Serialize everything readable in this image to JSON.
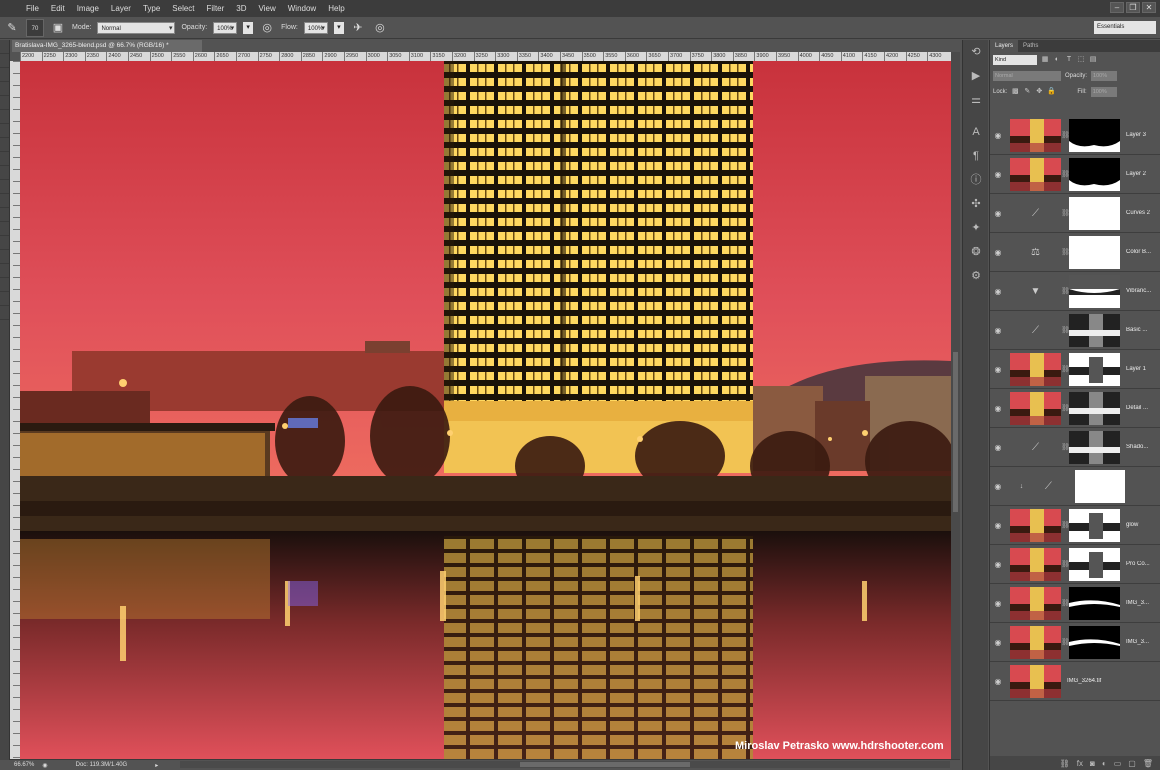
{
  "menubar": {
    "items": [
      "File",
      "Edit",
      "Image",
      "Layer",
      "Type",
      "Select",
      "Filter",
      "3D",
      "View",
      "Window",
      "Help"
    ]
  },
  "options": {
    "brush_size": "70",
    "mode_label": "Mode:",
    "mode_value": "Normal",
    "opacity_label": "Opacity:",
    "opacity_value": "100%",
    "flow_label": "Flow:",
    "flow_value": "100%",
    "workspace": "Essentials"
  },
  "document": {
    "tab_title": "Bratislava-IMG_3265-blend.psd @ 66.7% (RGB/16) *",
    "zoom": "66.67%",
    "doc_size": "Doc: 119.3M/1.40G",
    "watermark": "Miroslav Petrasko www.hdrshooter.com"
  },
  "ruler_ticks": [
    "2200",
    "2250",
    "2300",
    "2350",
    "2400",
    "2450",
    "2500",
    "2550",
    "2600",
    "2650",
    "2700",
    "2750",
    "2800",
    "2850",
    "2900",
    "2950",
    "3000",
    "3050",
    "3100",
    "3150",
    "3200",
    "3250",
    "3300",
    "3350",
    "3400",
    "3450",
    "3500",
    "3550",
    "3600",
    "3650",
    "3700",
    "3750",
    "3800",
    "3850",
    "3900",
    "3950",
    "4000",
    "4050",
    "4100",
    "4150",
    "4200",
    "4250",
    "4300"
  ],
  "layers_panel": {
    "tabs": [
      "Layers",
      "Paths"
    ],
    "filter_kind": "Kind",
    "blend_mode": "Normal",
    "opacity_label": "Opacity:",
    "opacity_value": "100%",
    "lock_label": "Lock:",
    "fill_label": "Fill:",
    "fill_value": "100%",
    "layers": [
      {
        "name": "Layer 3",
        "type": "image",
        "mask": "dark-bottom"
      },
      {
        "name": "Layer 2",
        "type": "image",
        "mask": "dark-bottom"
      },
      {
        "name": "Curves 2",
        "type": "adjust",
        "icon": "curves-icon",
        "mask": "white"
      },
      {
        "name": "Color B...",
        "type": "adjust",
        "icon": "balance-icon",
        "mask": "white"
      },
      {
        "name": "Vibranc...",
        "type": "adjust",
        "icon": "vibrance-icon",
        "mask": "partial"
      },
      {
        "name": "Basic ...",
        "type": "adjust",
        "icon": "curves-icon",
        "mask": "skyline"
      },
      {
        "name": "Layer 1",
        "type": "image",
        "mask": "skyline-white"
      },
      {
        "name": "Detail ...",
        "type": "image",
        "mask": "skyline"
      },
      {
        "name": "Shado...",
        "type": "adjust",
        "icon": "curves-icon",
        "mask": "skyline"
      },
      {
        "name": "",
        "type": "clip",
        "icon": "curves-icon",
        "mask": "white"
      },
      {
        "name": "glow",
        "type": "image",
        "mask": "skyline-white"
      },
      {
        "name": "Pro Co...",
        "type": "image",
        "mask": "skyline-white"
      },
      {
        "name": "IMG_3...",
        "type": "image",
        "mask": "black"
      },
      {
        "name": "IMG_3...",
        "type": "image",
        "mask": "black"
      },
      {
        "name": "IMG_3264.tif",
        "type": "image-only"
      }
    ]
  }
}
